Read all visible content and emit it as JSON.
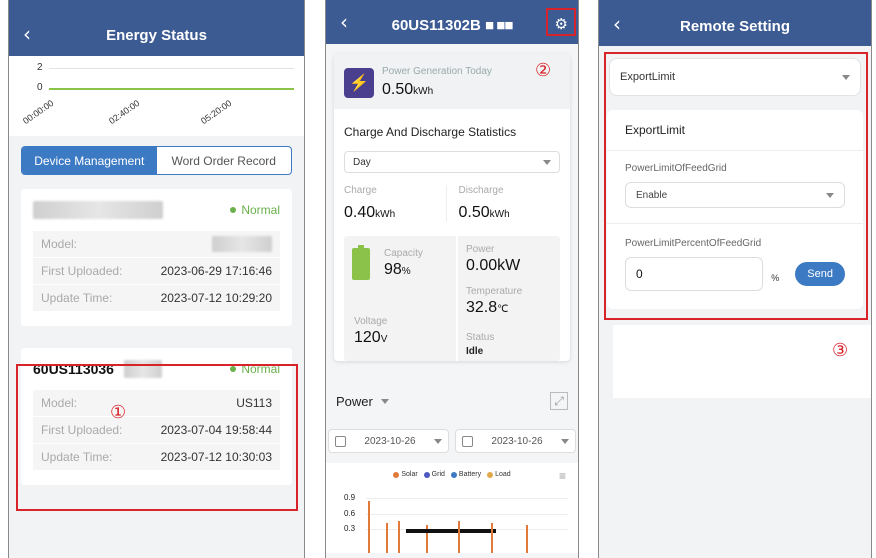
{
  "panel1": {
    "title": "Energy Status",
    "chart": {
      "y_ticks": [
        "2",
        "0"
      ],
      "x_ticks": [
        "00:00:00",
        "02:40:00",
        "05:20:00"
      ]
    },
    "tabs": [
      "Device Management",
      "Word Order Record"
    ],
    "device1": {
      "status": "Normal",
      "rows": [
        {
          "k": "Model:",
          "v": ""
        },
        {
          "k": "First Uploaded:",
          "v": "2023-06-29 17:16:46"
        },
        {
          "k": "Update Time:",
          "v": "2023-07-12 10:29:20"
        }
      ]
    },
    "device2": {
      "name": "60US113036",
      "status": "Normal",
      "rows": [
        {
          "k": "Model:",
          "v": "US113"
        },
        {
          "k": "First Uploaded:",
          "v": "2023-07-04 19:58:44"
        },
        {
          "k": "Update Time:",
          "v": "2023-07-12 10:30:03"
        }
      ]
    },
    "marker": "①"
  },
  "panel2": {
    "title": "60US11302B",
    "marker": "②",
    "gen_label": "Power Generation Today",
    "gen_value": "0.50",
    "gen_unit": "kWh",
    "section": "Charge And Discharge Statistics",
    "range": "Day",
    "charge_label": "Charge",
    "charge_value": "0.40",
    "charge_unit": "kWh",
    "discharge_label": "Discharge",
    "discharge_value": "0.50",
    "discharge_unit": "kWh",
    "capacity_label": "Capacity",
    "capacity_value": "98",
    "capacity_unit": "%",
    "power_label": "Power",
    "power_value": "0.00kW",
    "temp_label": "Temperature",
    "temp_value": "32.8",
    "temp_unit": "℃",
    "voltage_label": "Voltage",
    "voltage_value": "120",
    "voltage_unit": "V",
    "status_label": "Status",
    "status_value": "Idle",
    "power_select": "Power",
    "date_from": "2023-10-26",
    "date_to": "2023-10-26",
    "legend": [
      {
        "name": "Solar",
        "color": "#e07a3a"
      },
      {
        "name": "Grid",
        "color": "#4a58c0"
      },
      {
        "name": "Battery",
        "color": "#3d7ac4"
      },
      {
        "name": "Load",
        "color": "#e0a84a"
      }
    ],
    "y_ticks": [
      "0.9",
      "0.6",
      "0.3"
    ]
  },
  "panel3": {
    "title": "Remote Setting",
    "selector": "ExportLimit",
    "form_title": "ExportLimit",
    "field1_label": "PowerLimitOfFeedGrid",
    "field1_value": "Enable",
    "field2_label": "PowerLimitPercentOfFeedGrid",
    "field2_value": "0",
    "field2_unit": "%",
    "send": "Send",
    "marker": "③"
  }
}
